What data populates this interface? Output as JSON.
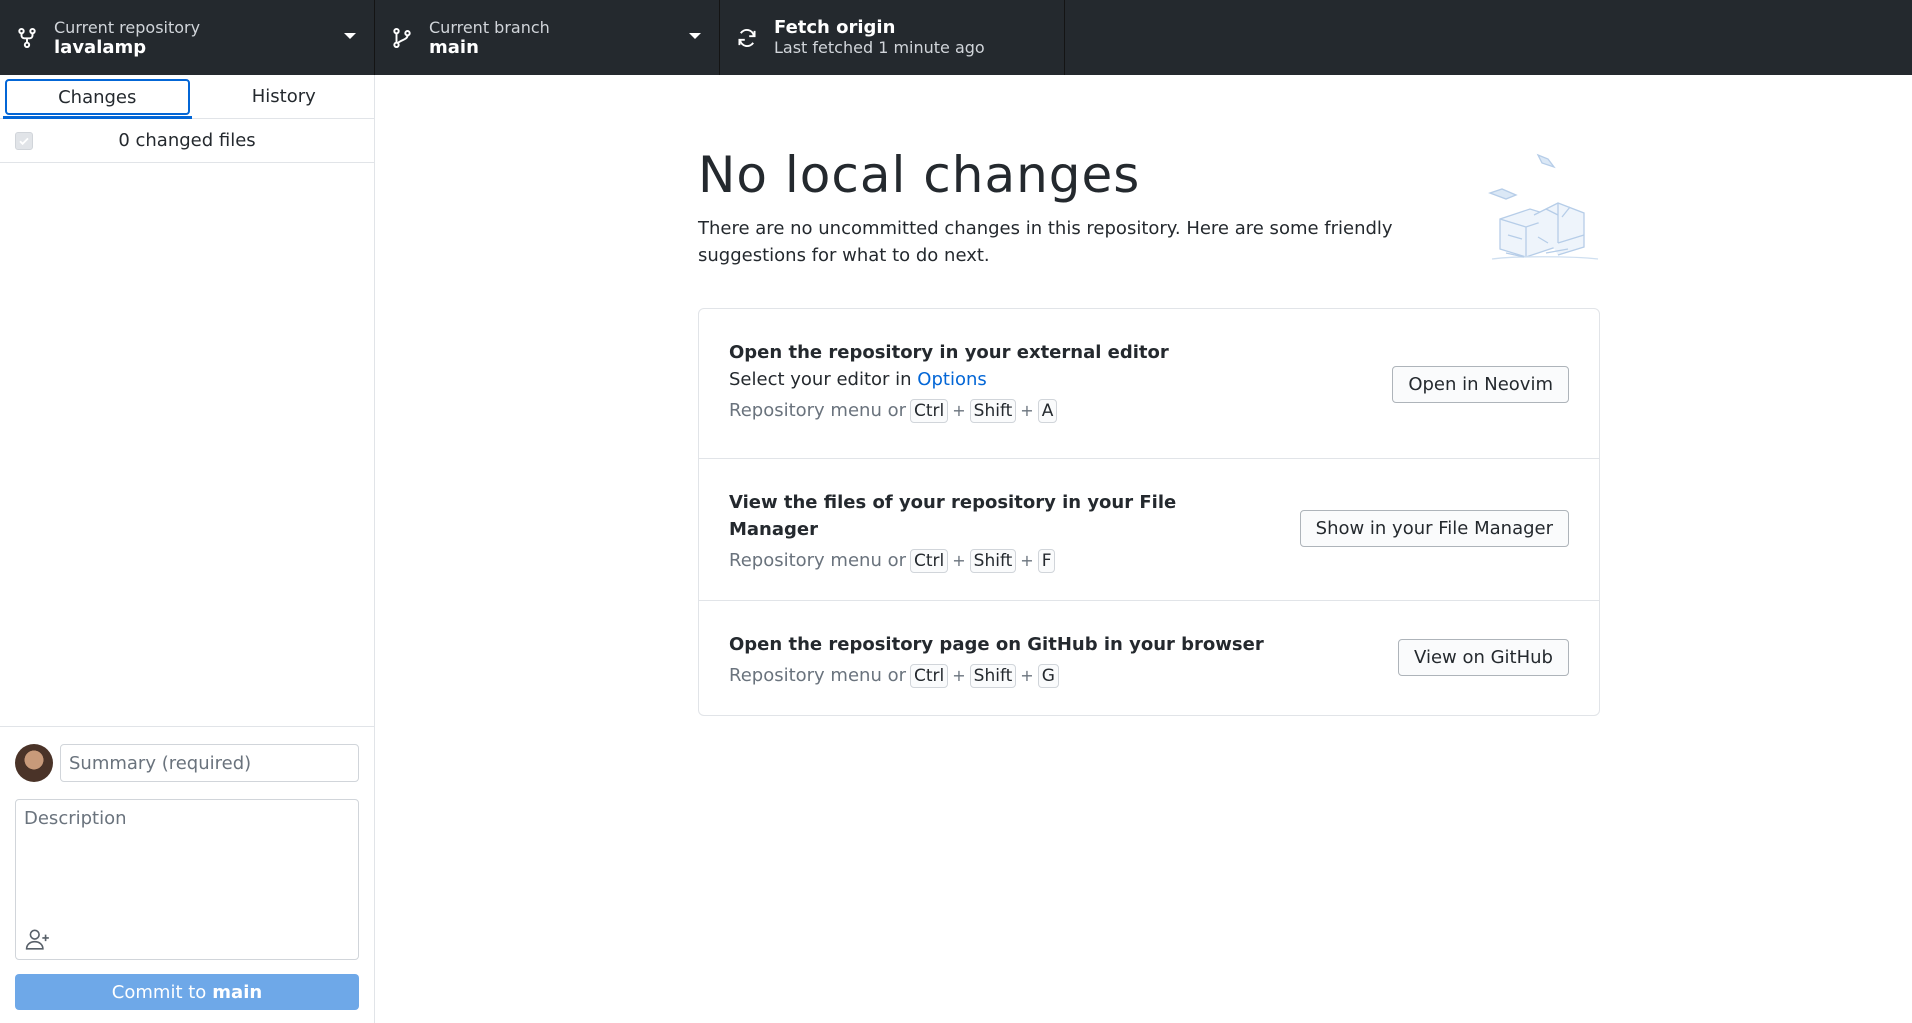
{
  "toolbar": {
    "repo": {
      "label": "Current repository",
      "value": "lavalamp",
      "icon": "repo-icon"
    },
    "branch": {
      "label": "Current branch",
      "value": "main",
      "icon": "branch-icon"
    },
    "fetch": {
      "label": "Fetch origin",
      "value": "Last fetched 1 minute ago",
      "icon": "sync-icon"
    }
  },
  "sidebar": {
    "tabs": [
      {
        "label": "Changes",
        "active": true
      },
      {
        "label": "History",
        "active": false
      }
    ],
    "files_count": "0 changed files",
    "commit": {
      "summary_placeholder": "Summary (required)",
      "description_placeholder": "Description",
      "button_prefix": "Commit to",
      "button_branch": "main"
    }
  },
  "main": {
    "title": "No local changes",
    "subtitle": "There are no uncommitted changes in this repository. Here are some friendly suggestions for what to do next.",
    "cards": [
      {
        "title": "Open the repository in your external editor",
        "sub_prefix": "Select your editor in",
        "sub_link": "Options",
        "shortcut_prefix": "Repository menu or",
        "keys": [
          "Ctrl",
          "Shift",
          "A"
        ],
        "button": "Open in Neovim"
      },
      {
        "title": "View the files of your repository in your File Manager",
        "shortcut_prefix": "Repository menu or",
        "keys": [
          "Ctrl",
          "Shift",
          "F"
        ],
        "button": "Show in your File Manager"
      },
      {
        "title": "Open the repository page on GitHub in your browser",
        "shortcut_prefix": "Repository menu or",
        "keys": [
          "Ctrl",
          "Shift",
          "G"
        ],
        "button": "View on GitHub"
      }
    ]
  },
  "colors": {
    "toolbar_bg": "#24292e",
    "accent": "#0366d6",
    "commit_button": "#6ea8e8"
  }
}
